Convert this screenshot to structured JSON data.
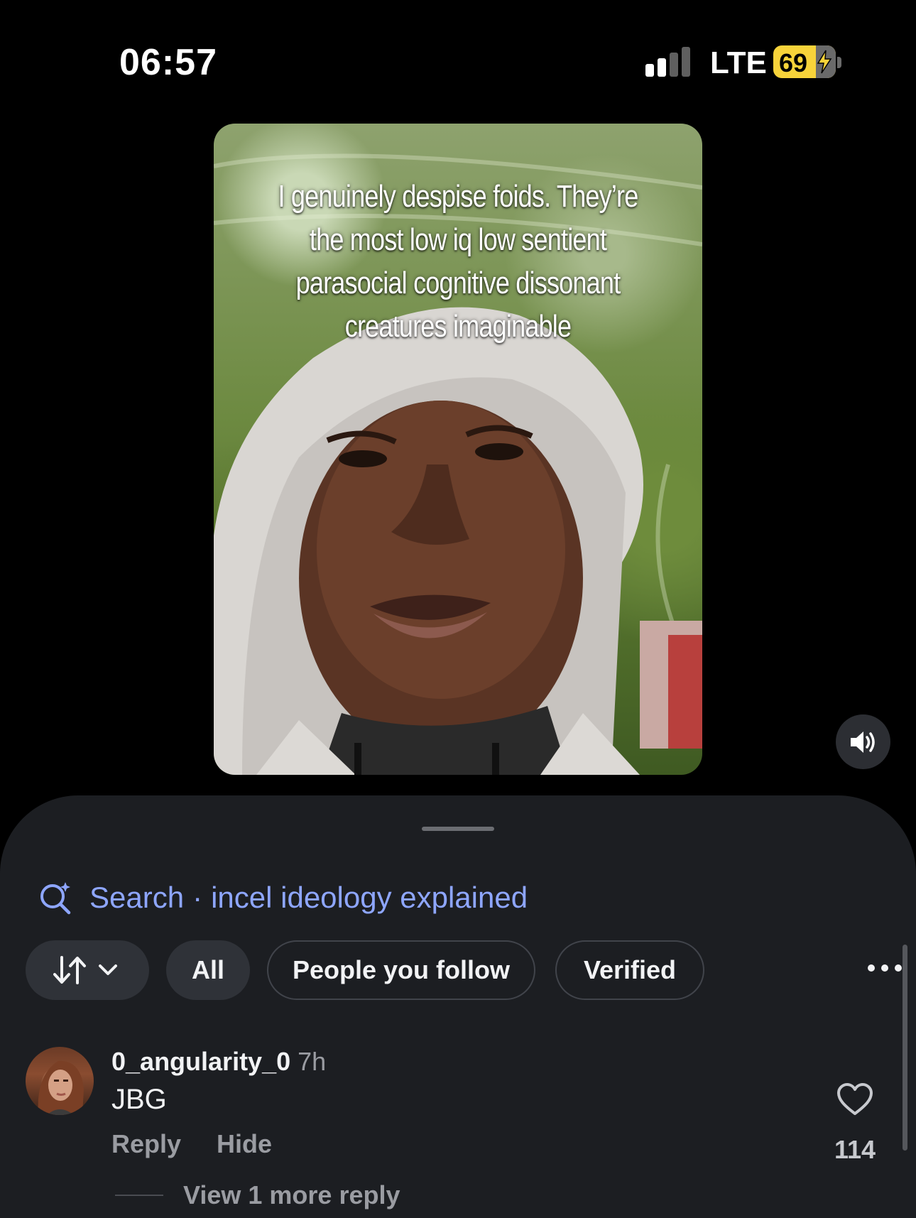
{
  "status_bar": {
    "time": "06:57",
    "network": "LTE",
    "battery_percent": "69",
    "signal_bars_active": 2,
    "signal_bars_total": 4
  },
  "video": {
    "caption": "I genuinely despise foids. They’re the most low iq low sentient parasocial cognitive dissonant creatures imaginable",
    "sound_icon": "speaker-volume-icon"
  },
  "comments": {
    "search": {
      "label": "Search",
      "separator": "·",
      "query": "incel ideology explained"
    },
    "filters": {
      "sort_icon": "sort-arrows-icon",
      "all": "All",
      "people_you_follow": "People you follow",
      "verified": "Verified"
    },
    "items": [
      {
        "username": "0_angularity_0",
        "time": "7h",
        "text": "JBG",
        "reply_label": "Reply",
        "hide_label": "Hide",
        "likes": "114",
        "view_more": "View 1 more reply"
      }
    ]
  },
  "colors": {
    "sheet_background": "#1c1e22",
    "search_accent": "#8ea6ff",
    "battery": "#f7d33a"
  }
}
